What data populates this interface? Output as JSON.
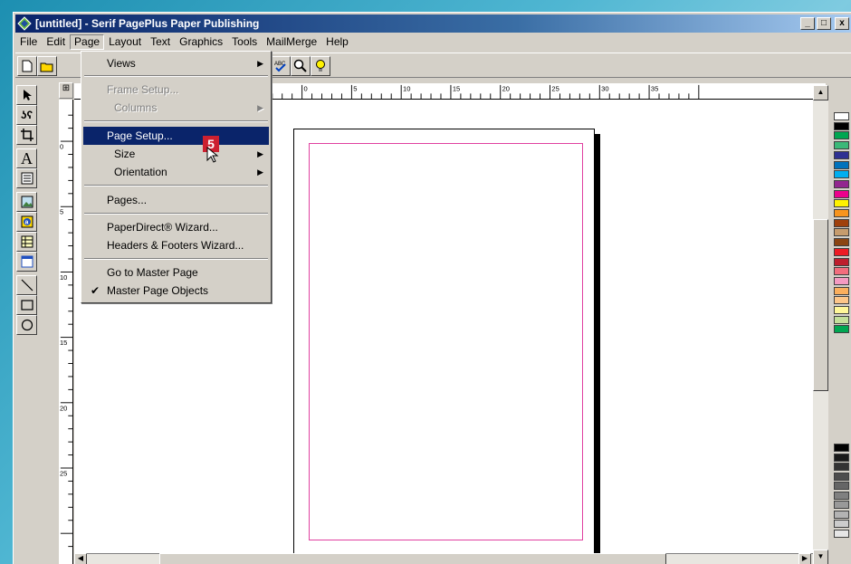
{
  "window": {
    "title": "[untitled] - Serif PagePlus Paper Publishing",
    "buttons": [
      "_",
      "□",
      "x"
    ]
  },
  "menubar": [
    {
      "label": "File",
      "key": "F"
    },
    {
      "label": "Edit",
      "key": "E"
    },
    {
      "label": "Page",
      "key": "P"
    },
    {
      "label": "Layout",
      "key": "L"
    },
    {
      "label": "Text",
      "key": "T"
    },
    {
      "label": "Graphics",
      "key": "G"
    },
    {
      "label": "Tools",
      "key": "o"
    },
    {
      "label": "MailMerge",
      "key": "M"
    },
    {
      "label": "Help",
      "key": "H"
    }
  ],
  "page_menu": {
    "items": [
      {
        "label": "Views",
        "submenu": true
      },
      {
        "label": "Frame Setup...",
        "disabled": true
      },
      {
        "label": "Columns",
        "disabled": true,
        "submenu": true
      },
      {
        "label": "Page Setup...",
        "highlighted": true
      },
      {
        "label": "Size",
        "submenu": true
      },
      {
        "label": "Orientation",
        "submenu": true
      },
      {
        "label": "Pages..."
      },
      {
        "label": "PaperDirect® Wizard..."
      },
      {
        "label": "Headers & Footers Wizard..."
      },
      {
        "label": "Go to Master Page"
      },
      {
        "label": "Master Page Objects",
        "checked": true
      }
    ]
  },
  "step_badge": "5",
  "hruler_labels": [
    "0",
    "5",
    "10",
    "15",
    "20",
    "25",
    "30",
    "35"
  ],
  "vruler_labels": [
    "0",
    "5",
    "10",
    "15",
    "20",
    "25"
  ],
  "colors": {
    "title_start": "#0a246a",
    "highlight": "#0a246a",
    "margin_guide": "#e040a0",
    "badge": "#cc2030"
  },
  "palette": [
    "#ffffff",
    "#000000",
    "#00a651",
    "#3cb878",
    "#2e3192",
    "#0072bc",
    "#00aeef",
    "#92278f",
    "#ec008c",
    "#fff200",
    "#f7941d",
    "#a0410d",
    "#c69c6d",
    "#8b4513",
    "#ed1c24",
    "#be1e2d",
    "#f26d7d",
    "#f49ac1",
    "#fbaf5d",
    "#fdc689",
    "#fff799",
    "#c4df9b",
    "#00a651"
  ],
  "grays": [
    "#000000",
    "#1a1a1a",
    "#333333",
    "#4d4d4d",
    "#666666",
    "#808080",
    "#999999",
    "#b3b3b3",
    "#cccccc",
    "#e6e6e6"
  ]
}
